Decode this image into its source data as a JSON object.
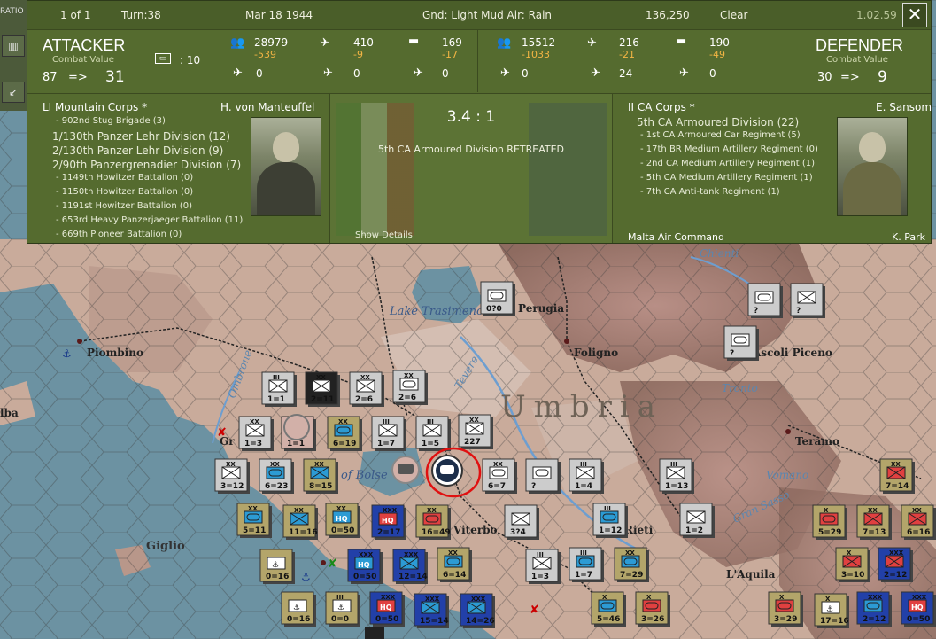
{
  "header": {
    "page": "1 of 1",
    "turn": "Turn:38",
    "date": "Mar 18 1944",
    "weather": "Gnd: Light Mud  Air: Rain",
    "points": "136,250",
    "sky": "Clear",
    "version": "1.02.59",
    "close": "✕"
  },
  "leftbar": {
    "tab": "RATIO"
  },
  "attacker": {
    "title": "ATTACKER",
    "cv_label": "Combat Value",
    "cv_before": "87",
    "arrow": "=>",
    "cv_after": "31",
    "armor_icon_count": ": 10",
    "men": "28979",
    "men_loss": "-539",
    "air": "410",
    "air_loss": "-9",
    "tanks": "169",
    "tanks_loss": "-17",
    "fighters": "0",
    "bombers": "0",
    "other": "0",
    "corps": "LI Mountain Corps *",
    "commander": "H. von Manteuffel",
    "units": [
      {
        "name": "- 902nd Stug Brigade (3)",
        "big": false
      },
      {
        "name": "1/130th Panzer Lehr Division (12)",
        "big": true
      },
      {
        "name": "2/130th Panzer Lehr Division (9)",
        "big": true
      },
      {
        "name": "2/90th Panzergrenadier Division (7)",
        "big": true
      },
      {
        "name": "- 1149th Howitzer Battalion (0)",
        "big": false
      },
      {
        "name": "- 1150th Howitzer Battalion (0)",
        "big": false
      },
      {
        "name": "- 1191st Howitzer Battalion (0)",
        "big": false
      },
      {
        "name": "- 653rd Heavy Panzerjaeger Battalion (11)",
        "big": false
      },
      {
        "name": "- 669th Pioneer Battalion (0)",
        "big": false
      }
    ]
  },
  "defender": {
    "title": "DEFENDER",
    "cv_label": "Combat Value",
    "cv_before": "30",
    "arrow": "=>",
    "cv_after": "9",
    "men": "15512",
    "men_loss": "-1033",
    "air": "216",
    "air_loss": "-21",
    "tanks": "190",
    "tanks_loss": "-49",
    "fighters": "0",
    "bombers": "24",
    "other": "0",
    "corps": "II CA Corps *",
    "commander": "E. Sansom",
    "units": [
      {
        "name": "5th CA Armoured Division (22)",
        "big": true
      },
      {
        "name": "- 1st CA Armoured Car Regiment (5)",
        "big": false
      },
      {
        "name": "- 17th BR Medium Artillery Regiment (0)",
        "big": false
      },
      {
        "name": "- 2nd CA Medium Artillery Regiment (1)",
        "big": false
      },
      {
        "name": "- 5th CA Medium Artillery Regiment (1)",
        "big": false
      },
      {
        "name": "- 7th CA Anti-tank Regiment (1)",
        "big": false
      }
    ],
    "extra_corps": "Malta Air Command",
    "extra_commander": "K. Park"
  },
  "combat": {
    "ratio": "3.4 : 1",
    "result": "5th CA Armoured Division RETREATED",
    "details_link": "Show Details"
  },
  "map": {
    "cities": {
      "piombino": "Piombino",
      "perugia": "Perugia",
      "foligno": "Foligno",
      "ascoli": "Ascoli Piceno",
      "teramo": "Teramo",
      "laquila": "L'Aquila",
      "rieti": "Rieti",
      "viterbo": "Viterbo",
      "giglio": "Giglio",
      "elba": "lba",
      "bolsena": "of Bolse",
      "gr": "Gr"
    },
    "region": "Umbria",
    "lake": "Lake Trasimeno",
    "rivers": {
      "tevere": "Tevere",
      "ombrone": "Ombrone",
      "chienti": "Chienti",
      "tronto": "Tronto",
      "vomano": "Vomano",
      "gransasso": "Gran Sasso"
    },
    "units": [
      {
        "id": "u1",
        "label": "2=11",
        "lvl": "XX"
      },
      {
        "id": "u2",
        "label": "1=1",
        "lvl": "III"
      },
      {
        "id": "u3",
        "label": "2=6",
        "lvl": "XX"
      },
      {
        "id": "u4",
        "label": "2=6",
        "lvl": "XX"
      },
      {
        "id": "u5",
        "label": "1=3",
        "lvl": "XX"
      },
      {
        "id": "u6",
        "label": "1=1",
        "lvl": ""
      },
      {
        "id": "u7",
        "label": "6=19",
        "lvl": "XX"
      },
      {
        "id": "u8",
        "label": "1=7",
        "lvl": "III"
      },
      {
        "id": "u9",
        "label": "1=5",
        "lvl": "III"
      },
      {
        "id": "u10",
        "label": "227",
        "lvl": "XX"
      },
      {
        "id": "u11",
        "label": "3=12",
        "lvl": "XX"
      },
      {
        "id": "u12",
        "label": "6=23",
        "lvl": "XX"
      },
      {
        "id": "u13",
        "label": "8=15",
        "lvl": "XX"
      },
      {
        "id": "u14",
        "label": "6=7",
        "lvl": "XX"
      },
      {
        "id": "u15",
        "label": "?",
        "lvl": ""
      },
      {
        "id": "u16",
        "label": "1=4",
        "lvl": "III"
      },
      {
        "id": "u17",
        "label": "1=13",
        "lvl": "III"
      },
      {
        "id": "u18",
        "label": "5=11",
        "lvl": "XX"
      },
      {
        "id": "u19",
        "label": "11=16",
        "lvl": "XX"
      },
      {
        "id": "u20",
        "label": "0=50",
        "lvl": "XX"
      },
      {
        "id": "u21",
        "label": "2=17",
        "lvl": "XXX"
      },
      {
        "id": "u22",
        "label": "16=49",
        "lvl": "XX"
      },
      {
        "id": "u23",
        "label": "3?4",
        "lvl": ""
      },
      {
        "id": "u24",
        "label": "1=12",
        "lvl": "III"
      },
      {
        "id": "u25",
        "label": "1=2",
        "lvl": ""
      },
      {
        "id": "u26",
        "label": "0=16",
        "lvl": ""
      },
      {
        "id": "u27",
        "label": "0=50",
        "lvl": "XXX"
      },
      {
        "id": "u28",
        "label": "12=14",
        "lvl": "XXX"
      },
      {
        "id": "u29",
        "label": "6=14",
        "lvl": "XX"
      },
      {
        "id": "u30",
        "label": "1=3",
        "lvl": "III"
      },
      {
        "id": "u31",
        "label": "1=7",
        "lvl": "III"
      },
      {
        "id": "u32",
        "label": "7=29",
        "lvl": "XX"
      },
      {
        "id": "u33",
        "label": "0=16",
        "lvl": ""
      },
      {
        "id": "u34",
        "label": "0=0",
        "lvl": "III"
      },
      {
        "id": "u35",
        "label": "0=50",
        "lvl": "XXX"
      },
      {
        "id": "u36",
        "label": "15=14",
        "lvl": "XXX"
      },
      {
        "id": "u37",
        "label": "14=26",
        "lvl": "XXX"
      },
      {
        "id": "u38",
        "label": "5=46",
        "lvl": "X"
      },
      {
        "id": "u39",
        "label": "3=26",
        "lvl": "X"
      },
      {
        "id": "u40",
        "label": "3=29",
        "lvl": "X"
      },
      {
        "id": "u41",
        "label": "17=16",
        "lvl": "X"
      },
      {
        "id": "u42",
        "label": "2=12",
        "lvl": "XXX"
      },
      {
        "id": "u43",
        "label": "0=50",
        "lvl": "XXX"
      },
      {
        "id": "u44",
        "label": "3=10",
        "lvl": "X"
      },
      {
        "id": "u45",
        "label": "2=12",
        "lvl": "XXX"
      },
      {
        "id": "u46",
        "label": "5=29",
        "lvl": "X"
      },
      {
        "id": "u47",
        "label": "7=13",
        "lvl": "XX"
      },
      {
        "id": "u48",
        "label": "6=16",
        "lvl": "XX"
      },
      {
        "id": "u49",
        "label": "7=14",
        "lvl": "XX"
      },
      {
        "id": "u50",
        "label": "0?0",
        "lvl": ""
      },
      {
        "id": "u51",
        "label": "?",
        "lvl": ""
      },
      {
        "id": "u52",
        "label": "?",
        "lvl": ""
      },
      {
        "id": "u53",
        "label": "?",
        "lvl": ""
      }
    ]
  }
}
